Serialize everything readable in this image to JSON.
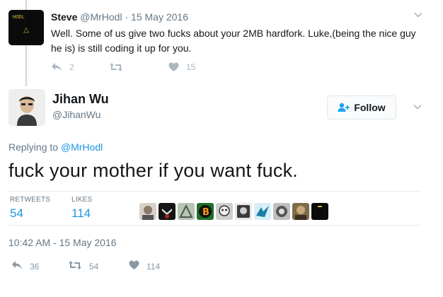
{
  "parent_tweet": {
    "avatar_text": "HODL",
    "name": "Steve",
    "handle": "@MrHodl",
    "date": "15 May 2016",
    "text": "Well. Some of us give two fucks about your 2MB hardfork. Luke,(being the nice guy he is) is still coding it up for you.",
    "replies": "2",
    "retweets": "",
    "likes": "15"
  },
  "main_tweet": {
    "name": "Jihan Wu",
    "handle": "@JihanWu",
    "follow_label": "Follow",
    "replying_prefix": "Replying to",
    "replying_handle": "@MrHodl",
    "text": "fuck your mother if you want fuck.",
    "retweets_label": "RETWEETS",
    "retweets_count": "54",
    "likes_label": "LIKES",
    "likes_count": "114",
    "timestamp": "10:42 AM - 15 May 2016",
    "actions": {
      "replies": "36",
      "retweets": "54",
      "likes": "114"
    }
  },
  "colors": {
    "accent": "#1b95e0",
    "muted": "#657786",
    "icon": "#aab8c2",
    "divider": "#e6ecf0"
  },
  "liker_avatars": [
    {
      "name": "liker-1",
      "color": "#7a6a5a"
    },
    {
      "name": "liker-2",
      "color": "#1a1a1a"
    },
    {
      "name": "liker-3",
      "color": "#8fa08a"
    },
    {
      "name": "liker-4",
      "color": "#1f6e2b"
    },
    {
      "name": "liker-5",
      "color": "#9a9a9a"
    },
    {
      "name": "liker-6",
      "color": "#3a3a3a"
    },
    {
      "name": "liker-7",
      "color": "#1d7fa8"
    },
    {
      "name": "liker-8",
      "color": "#555555"
    },
    {
      "name": "liker-9",
      "color": "#6a5a3a"
    },
    {
      "name": "liker-10",
      "color": "#0a0a0a"
    }
  ]
}
